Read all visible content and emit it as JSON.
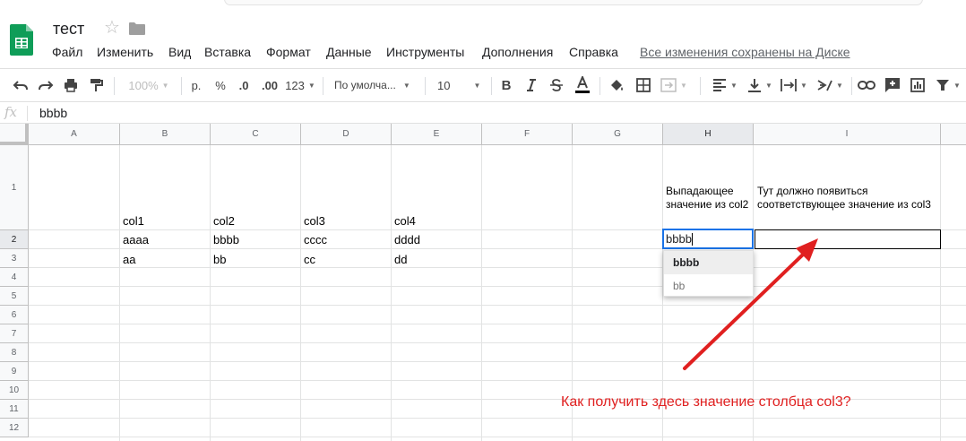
{
  "doc": {
    "title": "тест"
  },
  "menu": {
    "items": [
      "Файл",
      "Изменить",
      "Вид",
      "Вставка",
      "Формат",
      "Данные",
      "Инструменты",
      "Дополнения",
      "Справка"
    ],
    "save_status": "Все изменения сохранены на Диске"
  },
  "toolbar": {
    "zoom": "100%",
    "currency": "р.",
    "percent": "%",
    "dec_less": ".0",
    "dec_more": ".00",
    "format_more": "123",
    "font": "По умолча...",
    "font_size": "10",
    "bold": "B"
  },
  "formula": {
    "fx": "fx",
    "value": "bbbb"
  },
  "columns": [
    "A",
    "B",
    "C",
    "D",
    "E",
    "F",
    "G",
    "H",
    "I"
  ],
  "rows": [
    "1",
    "2",
    "3",
    "4",
    "5",
    "6",
    "7",
    "8",
    "9",
    "10",
    "11",
    "12"
  ],
  "cells": {
    "B1": "col1",
    "C1": "col2",
    "D1": "col3",
    "E1": "col4",
    "B2": "aaaa",
    "C2": "bbbb",
    "D2": "cccc",
    "E2": "dddd",
    "B3": "aa",
    "C3": "bb",
    "D3": "cc",
    "E3": "dd",
    "H1": "Выпадающее значение из col2",
    "I1": "Тут должно появиться соответствующее значение из col3",
    "H2": "bbbb"
  },
  "dropdown": {
    "options": [
      "bbbb",
      "bb"
    ]
  },
  "annotation": "Как получить здесь значение столбца col3?",
  "colors": {
    "accent": "#1a73e8",
    "annotation": "#e02020",
    "logo": "#0f9d58"
  }
}
